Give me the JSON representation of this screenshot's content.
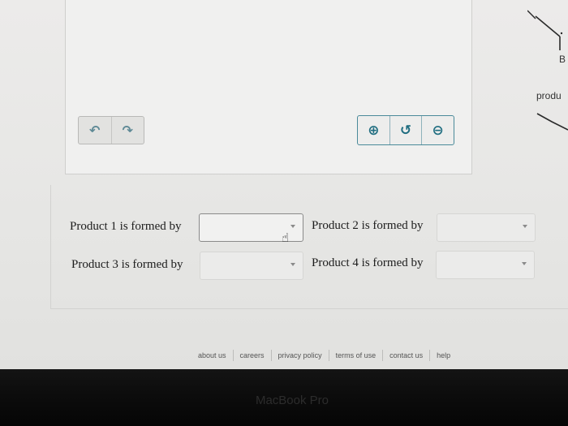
{
  "canvas": {
    "undo_icon": "undo-icon",
    "redo_icon": "redo-icon",
    "zoom_in_icon": "zoom-in-icon",
    "reset_zoom_icon": "reset-zoom-icon",
    "zoom_out_icon": "zoom-out-icon"
  },
  "side_structure": {
    "atom_label": "B",
    "caption": "produ"
  },
  "questions": [
    {
      "label": "Product 1 is formed by",
      "selected": ""
    },
    {
      "label": "Product 2 is formed by",
      "selected": ""
    },
    {
      "label": "Product 3 is formed by",
      "selected": ""
    },
    {
      "label": "Product 4 is formed by",
      "selected": ""
    }
  ],
  "footer": {
    "links": [
      "about us",
      "careers",
      "privacy policy",
      "terms of use",
      "contact us",
      "help"
    ]
  },
  "device": {
    "bezel_label": "MacBook Pro"
  },
  "colors": {
    "accent": "#1f6d80",
    "page_bg": "#e8e8e6"
  }
}
